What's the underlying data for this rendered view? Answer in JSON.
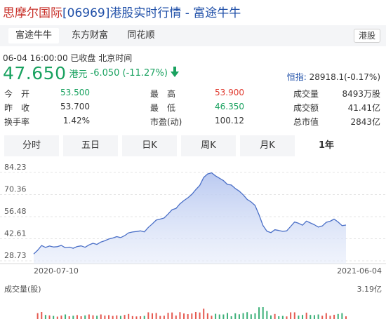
{
  "title": {
    "brand": "思摩尔国际",
    "rest": "[06969]港股实时行情 - 富途牛牛"
  },
  "source_tabs": [
    {
      "label": "富途牛牛",
      "active": true
    },
    {
      "label": "东方财富",
      "active": false
    },
    {
      "label": "同花顺",
      "active": false
    }
  ],
  "market_badge": "港股",
  "quote": {
    "datetime": "06-04 16:00:00",
    "status": "已收盘",
    "timezone": "北京时间",
    "price": "47.650",
    "currency": "港元",
    "change": "-6.050 (-11.27%)",
    "direction": "down",
    "index_label": "恒指:",
    "index_value": "28918.1(-0.17%)"
  },
  "stats": [
    {
      "label": "今　开",
      "value": "53.500",
      "tone": "green"
    },
    {
      "label": "昨　收",
      "value": "53.700",
      "tone": "plain"
    },
    {
      "label": "换手率",
      "value": "1.42%",
      "tone": "plain"
    },
    {
      "label": "最　高",
      "value": "53.900",
      "tone": "red"
    },
    {
      "label": "最　低",
      "value": "46.350",
      "tone": "green"
    },
    {
      "label": "市盈(动)",
      "value": "100.12",
      "tone": "plain"
    },
    {
      "label": "成交量",
      "value": "8493万股",
      "tone": "plain"
    },
    {
      "label": "成交额",
      "value": "41.41亿",
      "tone": "plain"
    },
    {
      "label": "总市值",
      "value": "2843亿",
      "tone": "plain"
    }
  ],
  "period_tabs": [
    {
      "label": "分时",
      "active": false
    },
    {
      "label": "五日",
      "active": false
    },
    {
      "label": "日K",
      "active": false
    },
    {
      "label": "周K",
      "active": false
    },
    {
      "label": "月K",
      "active": false
    },
    {
      "label": "1年",
      "active": true
    }
  ],
  "colors": {
    "up": "#e03c31",
    "down": "#1aa260",
    "line": "#4a6fc7",
    "fill": "#c9d5f4",
    "link": "#1f4fa8"
  },
  "chart_data": {
    "type": "area",
    "title": "",
    "xlabel": "",
    "ylabel": "",
    "y_ticks": [
      84.23,
      70.36,
      56.48,
      42.61,
      28.73
    ],
    "ylim": [
      28.73,
      84.23
    ],
    "x_start_label": "2020-07-10",
    "x_end_label": "2021-06-04",
    "series": [
      {
        "values": [
          29.5,
          31.8,
          34.8,
          33.6,
          34.5,
          33.9,
          34.1,
          34.9,
          33.4,
          33.8,
          33.1,
          34.2,
          34.6,
          33.7,
          35.2,
          36.2,
          35.5,
          37.0,
          37.8,
          38.9,
          39.5,
          40.4,
          39.8,
          41.0,
          42.8,
          43.3,
          43.6,
          44.0,
          43.4,
          46.2,
          48.4,
          50.8,
          51.4,
          52.1,
          54.6,
          57.3,
          58.1,
          61.0,
          63.1,
          64.8,
          66.9,
          69.9,
          72.6,
          77.6,
          79.8,
          80.5,
          78.6,
          77.1,
          75.6,
          73.2,
          72.8,
          70.6,
          69.0,
          66.7,
          63.8,
          62.2,
          60.0,
          54.1,
          47.4,
          43.8,
          42.9,
          44.7,
          44.3,
          43.7,
          44.0,
          46.8,
          49.6,
          48.8,
          47.6,
          50.2,
          49.0,
          47.9,
          46.4,
          47.1,
          49.4,
          50.1,
          51.4,
          49.6,
          47.3,
          47.65
        ]
      }
    ],
    "volume": {
      "label": "成交量(股)",
      "max_label": "3.19亿"
    }
  }
}
